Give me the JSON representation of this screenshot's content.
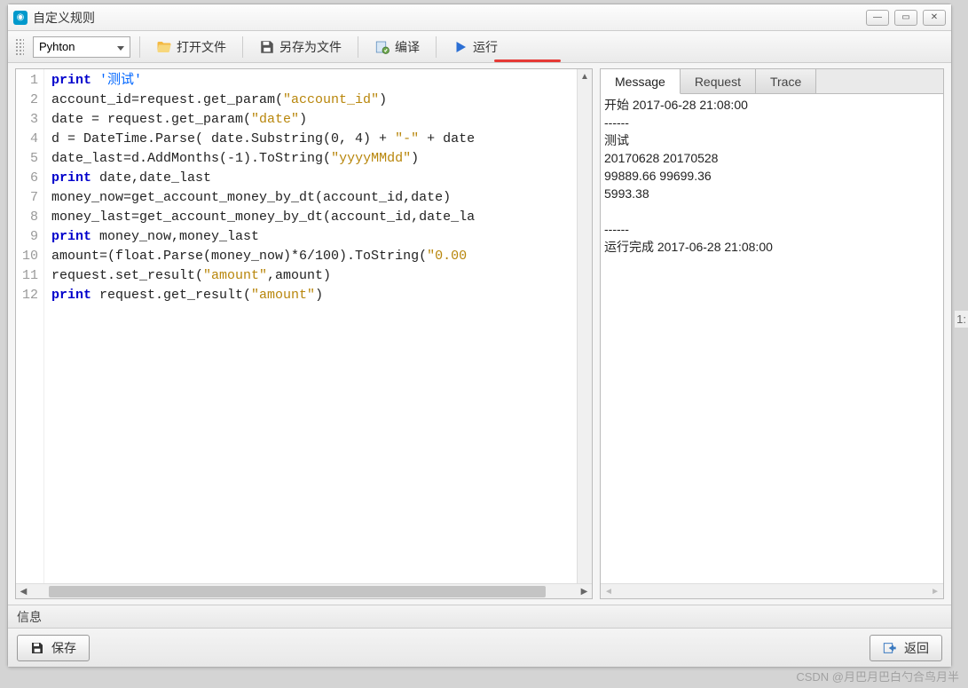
{
  "window": {
    "title": "自定义规则"
  },
  "toolbar": {
    "language": "Pyhton",
    "open": "打开文件",
    "saveas": "另存为文件",
    "compile": "编译",
    "run": "运行"
  },
  "code": {
    "line_count": 12,
    "lines": [
      {
        "n": 1,
        "tokens": [
          {
            "t": "kw",
            "v": "print"
          },
          {
            "t": "plain",
            "v": " "
          },
          {
            "t": "chn",
            "v": "'测试'"
          }
        ]
      },
      {
        "n": 2,
        "tokens": [
          {
            "t": "plain",
            "v": "account_id=request.get_param("
          },
          {
            "t": "str",
            "v": "\"account_id\""
          },
          {
            "t": "plain",
            "v": ")"
          }
        ]
      },
      {
        "n": 3,
        "tokens": [
          {
            "t": "plain",
            "v": "date = request.get_param("
          },
          {
            "t": "str",
            "v": "\"date\""
          },
          {
            "t": "plain",
            "v": ")"
          }
        ]
      },
      {
        "n": 4,
        "tokens": [
          {
            "t": "plain",
            "v": "d = DateTime.Parse( date.Substring(0, 4) + "
          },
          {
            "t": "str",
            "v": "\"-\""
          },
          {
            "t": "plain",
            "v": " + date"
          }
        ]
      },
      {
        "n": 5,
        "tokens": [
          {
            "t": "plain",
            "v": "date_last=d.AddMonths(-1).ToString("
          },
          {
            "t": "str",
            "v": "\"yyyyMMdd\""
          },
          {
            "t": "plain",
            "v": ")"
          }
        ]
      },
      {
        "n": 6,
        "tokens": [
          {
            "t": "kw",
            "v": "print"
          },
          {
            "t": "plain",
            "v": " date,date_last"
          }
        ]
      },
      {
        "n": 7,
        "tokens": [
          {
            "t": "plain",
            "v": "money_now=get_account_money_by_dt(account_id,date)"
          }
        ]
      },
      {
        "n": 8,
        "tokens": [
          {
            "t": "plain",
            "v": "money_last=get_account_money_by_dt(account_id,date_la"
          }
        ]
      },
      {
        "n": 9,
        "tokens": [
          {
            "t": "kw",
            "v": "print"
          },
          {
            "t": "plain",
            "v": " money_now,money_last"
          }
        ]
      },
      {
        "n": 10,
        "tokens": [
          {
            "t": "plain",
            "v": "amount=(float.Parse(money_now)*6/100).ToString("
          },
          {
            "t": "str",
            "v": "\"0.00"
          }
        ]
      },
      {
        "n": 11,
        "tokens": [
          {
            "t": "plain",
            "v": "request.set_result("
          },
          {
            "t": "str",
            "v": "\"amount\""
          },
          {
            "t": "plain",
            "v": ",amount)"
          }
        ]
      },
      {
        "n": 12,
        "tokens": [
          {
            "t": "kw",
            "v": "print"
          },
          {
            "t": "plain",
            "v": " request.get_result("
          },
          {
            "t": "str",
            "v": "\"amount\""
          },
          {
            "t": "plain",
            "v": ")"
          }
        ]
      }
    ]
  },
  "tabs": {
    "message": "Message",
    "request": "Request",
    "trace": "Trace"
  },
  "output_lines": [
    "开始 2017-06-28 21:08:00",
    "------",
    "测试",
    "20170628 20170528",
    "99889.66 99699.36",
    "5993.38",
    "",
    "------",
    "运行完成 2017-06-28 21:08:00"
  ],
  "info_label": "信息",
  "footer": {
    "save": "保存",
    "back": "返回"
  },
  "watermark": "CSDN @月巴月巴白勺合鸟月半",
  "side_fragment": "1:"
}
